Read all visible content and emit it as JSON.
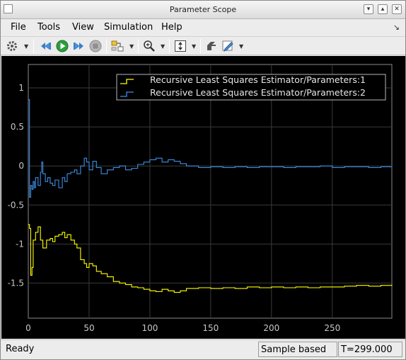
{
  "window": {
    "title": "Parameter Scope"
  },
  "menu": {
    "file": "File",
    "tools": "Tools",
    "view": "View",
    "simulation": "Simulation",
    "help": "Help"
  },
  "toolbar": {
    "icons": [
      "gear-icon",
      "step-back-icon",
      "run-icon",
      "step-forward-icon",
      "stop-icon",
      "highlight-block-icon",
      "zoom-icon",
      "scale-axes-icon",
      "style-icon",
      "edit-icon"
    ]
  },
  "status": {
    "ready": "Ready",
    "mode": "Sample based",
    "time": "T=299.000"
  },
  "colors": {
    "background": "#000000",
    "grid": "#3a3a3a",
    "series1": "#ffff00",
    "series2": "#3d8ee6"
  },
  "chart_data": {
    "type": "line",
    "title": "",
    "xlabel": "",
    "ylabel": "",
    "xlim": [
      0,
      299
    ],
    "ylim": [
      -1.95,
      1.3
    ],
    "xticks": [
      "0",
      "50",
      "100",
      "150",
      "200",
      "250"
    ],
    "xtick_values": [
      0,
      50,
      100,
      150,
      200,
      250
    ],
    "yticks": [
      "1",
      "0.5",
      "0",
      "-0.5",
      "-1",
      "-1.5"
    ],
    "ytick_values": [
      1,
      0.5,
      0,
      -0.5,
      -1,
      -1.5
    ],
    "grid": true,
    "legend_position": "top-right",
    "series": [
      {
        "name": "Recursive Least Squares Estimator/Parameters:1",
        "color": "#ffff00",
        "step": true,
        "x": [
          0,
          1,
          2,
          3,
          4,
          6,
          8,
          10,
          12,
          15,
          18,
          20,
          22,
          25,
          28,
          30,
          32,
          35,
          38,
          40,
          43,
          46,
          48,
          50,
          53,
          56,
          60,
          65,
          70,
          75,
          80,
          85,
          90,
          95,
          100,
          105,
          110,
          115,
          120,
          125,
          130,
          140,
          150,
          160,
          170,
          180,
          190,
          200,
          210,
          220,
          230,
          240,
          250,
          260,
          270,
          280,
          290,
          299
        ],
        "y": [
          -0.75,
          -0.8,
          -1.4,
          -1.3,
          -0.95,
          -0.85,
          -0.78,
          -0.95,
          -1.05,
          -0.95,
          -0.93,
          -0.97,
          -0.9,
          -0.88,
          -0.85,
          -0.92,
          -0.88,
          -0.95,
          -1.0,
          -1.05,
          -1.2,
          -1.25,
          -1.3,
          -1.25,
          -1.28,
          -1.35,
          -1.38,
          -1.42,
          -1.48,
          -1.5,
          -1.52,
          -1.55,
          -1.56,
          -1.58,
          -1.6,
          -1.61,
          -1.58,
          -1.6,
          -1.62,
          -1.6,
          -1.57,
          -1.56,
          -1.57,
          -1.56,
          -1.57,
          -1.55,
          -1.56,
          -1.55,
          -1.56,
          -1.55,
          -1.56,
          -1.55,
          -1.55,
          -1.54,
          -1.53,
          -1.54,
          -1.53,
          -1.52
        ]
      },
      {
        "name": "Recursive Least Squares Estimator/Parameters:2",
        "color": "#3d8ee6",
        "step": true,
        "x": [
          0,
          1,
          2,
          3,
          4,
          5,
          6,
          8,
          10,
          11,
          12,
          14,
          16,
          18,
          20,
          22,
          25,
          28,
          30,
          32,
          35,
          38,
          40,
          43,
          46,
          48,
          50,
          53,
          56,
          60,
          65,
          70,
          75,
          80,
          85,
          90,
          95,
          100,
          105,
          110,
          115,
          120,
          125,
          130,
          140,
          150,
          160,
          170,
          180,
          190,
          200,
          210,
          220,
          230,
          240,
          250,
          260,
          270,
          280,
          290,
          299
        ],
        "y": [
          0.85,
          -0.4,
          -0.25,
          -0.3,
          -0.2,
          -0.28,
          -0.15,
          -0.25,
          -0.08,
          0.05,
          -0.1,
          -0.2,
          -0.15,
          -0.22,
          -0.25,
          -0.18,
          -0.28,
          -0.15,
          -0.2,
          -0.1,
          -0.08,
          -0.05,
          -0.1,
          0.0,
          0.1,
          0.05,
          -0.05,
          0.06,
          -0.02,
          -0.1,
          -0.05,
          -0.02,
          0.0,
          -0.05,
          -0.03,
          0.02,
          0.05,
          0.08,
          0.1,
          0.05,
          0.08,
          0.06,
          0.03,
          0.0,
          -0.02,
          -0.01,
          -0.02,
          -0.01,
          -0.02,
          -0.01,
          -0.01,
          -0.02,
          -0.01,
          -0.01,
          0.0,
          -0.02,
          -0.01,
          -0.01,
          -0.02,
          -0.01,
          -0.03
        ]
      }
    ]
  }
}
